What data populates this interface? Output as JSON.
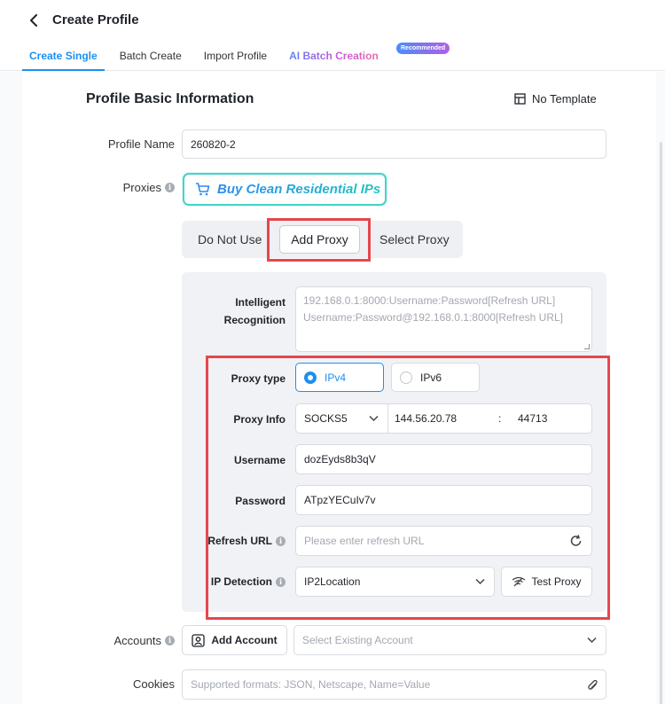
{
  "header": {
    "title": "Create Profile",
    "tabs": [
      "Create Single",
      "Batch Create",
      "Import Profile",
      "AI Batch Creation"
    ],
    "badge": "Recommended"
  },
  "section": {
    "title": "Profile Basic Information",
    "no_template": "No Template"
  },
  "profile_name": {
    "label": "Profile Name",
    "value": "260820-2"
  },
  "proxies": {
    "label": "Proxies",
    "buy_label": "Buy Clean Residential IPs",
    "modes": [
      "Do Not Use",
      "Add Proxy",
      "Select Proxy"
    ]
  },
  "intelligent": {
    "label_line1": "Intelligent",
    "label_line2": "Recognition",
    "placeholder_line1": "192.168.0.1:8000:Username:Password[Refresh URL]",
    "placeholder_line2": "Username:Password@192.168.0.1:8000[Refresh URL]"
  },
  "proxy_type": {
    "label": "Proxy type",
    "options": [
      "IPv4",
      "IPv6"
    ],
    "selected": "IPv4"
  },
  "proxy_info": {
    "label": "Proxy Info",
    "protocol": "SOCKS5",
    "host": "144.56.20.78",
    "separator": ":",
    "port": "44713"
  },
  "username": {
    "label": "Username",
    "value": "dozEyds8b3qV"
  },
  "password": {
    "label": "Password",
    "value": "ATpzYECuIv7v"
  },
  "refresh_url": {
    "label": "Refresh URL",
    "placeholder": "Please enter refresh URL"
  },
  "ip_detection": {
    "label": "IP Detection",
    "value": "IP2Location",
    "test_label": "Test Proxy"
  },
  "accounts": {
    "label": "Accounts",
    "add_label": "Add Account",
    "select_placeholder": "Select Existing Account"
  },
  "cookies": {
    "label": "Cookies",
    "placeholder": "Supported formats: JSON, Netscape, Name=Value"
  },
  "colors": {
    "accent": "#1d8ff0",
    "highlight": "#e5474c",
    "buy_border": "#45d3c8"
  }
}
